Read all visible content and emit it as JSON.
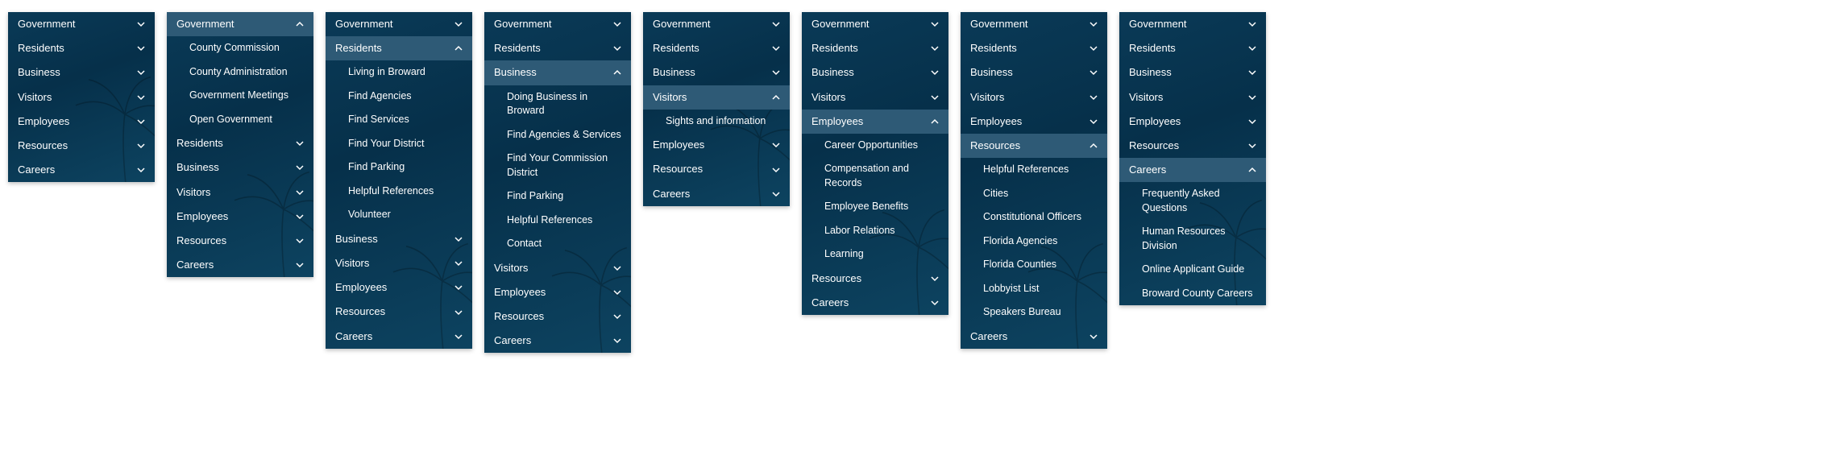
{
  "panels": [
    {
      "expanded_index": -1,
      "sections": [
        {
          "label": "Government",
          "children": []
        },
        {
          "label": "Residents",
          "children": []
        },
        {
          "label": "Business",
          "children": []
        },
        {
          "label": "Visitors",
          "children": []
        },
        {
          "label": "Employees",
          "children": []
        },
        {
          "label": "Resources",
          "children": []
        },
        {
          "label": "Careers",
          "children": []
        }
      ]
    },
    {
      "expanded_index": 0,
      "sections": [
        {
          "label": "Government",
          "children": [
            "County Commission",
            "County Administration",
            "Government Meetings",
            "Open Government"
          ]
        },
        {
          "label": "Residents",
          "children": []
        },
        {
          "label": "Business",
          "children": []
        },
        {
          "label": "Visitors",
          "children": []
        },
        {
          "label": "Employees",
          "children": []
        },
        {
          "label": "Resources",
          "children": []
        },
        {
          "label": "Careers",
          "children": []
        }
      ]
    },
    {
      "expanded_index": 1,
      "sections": [
        {
          "label": "Government",
          "children": []
        },
        {
          "label": "Residents",
          "children": [
            "Living in Broward",
            "Find Agencies",
            "Find Services",
            "Find Your District",
            "Find Parking",
            "Helpful References",
            "Volunteer"
          ]
        },
        {
          "label": "Business",
          "children": []
        },
        {
          "label": "Visitors",
          "children": []
        },
        {
          "label": "Employees",
          "children": []
        },
        {
          "label": "Resources",
          "children": []
        },
        {
          "label": "Careers",
          "children": []
        }
      ]
    },
    {
      "expanded_index": 2,
      "sections": [
        {
          "label": "Government",
          "children": []
        },
        {
          "label": "Residents",
          "children": []
        },
        {
          "label": "Business",
          "children": [
            "Doing Business in Broward",
            "Find Agencies & Services",
            "Find Your Commission District",
            "Find Parking",
            "Helpful References",
            "Contact"
          ]
        },
        {
          "label": "Visitors",
          "children": []
        },
        {
          "label": "Employees",
          "children": []
        },
        {
          "label": "Resources",
          "children": []
        },
        {
          "label": "Careers",
          "children": []
        }
      ]
    },
    {
      "expanded_index": 3,
      "sections": [
        {
          "label": "Government",
          "children": []
        },
        {
          "label": "Residents",
          "children": []
        },
        {
          "label": "Business",
          "children": []
        },
        {
          "label": "Visitors",
          "children": [
            "Sights and information"
          ]
        },
        {
          "label": "Employees",
          "children": []
        },
        {
          "label": "Resources",
          "children": []
        },
        {
          "label": "Careers",
          "children": []
        }
      ]
    },
    {
      "expanded_index": 4,
      "sections": [
        {
          "label": "Government",
          "children": []
        },
        {
          "label": "Residents",
          "children": []
        },
        {
          "label": "Business",
          "children": []
        },
        {
          "label": "Visitors",
          "children": []
        },
        {
          "label": "Employees",
          "children": [
            "Career Opportunities",
            "Compensation and Records",
            "Employee Benefits",
            "Labor Relations",
            "Learning"
          ]
        },
        {
          "label": "Resources",
          "children": []
        },
        {
          "label": "Careers",
          "children": []
        }
      ]
    },
    {
      "expanded_index": 5,
      "sections": [
        {
          "label": "Government",
          "children": []
        },
        {
          "label": "Residents",
          "children": []
        },
        {
          "label": "Business",
          "children": []
        },
        {
          "label": "Visitors",
          "children": []
        },
        {
          "label": "Employees",
          "children": []
        },
        {
          "label": "Resources",
          "children": [
            "Helpful References",
            "Cities",
            "Constitutional Officers",
            "Florida Agencies",
            "Florida Counties",
            "Lobbyist List",
            "Speakers Bureau"
          ]
        },
        {
          "label": "Careers",
          "children": []
        }
      ]
    },
    {
      "expanded_index": 6,
      "sections": [
        {
          "label": "Government",
          "children": []
        },
        {
          "label": "Residents",
          "children": []
        },
        {
          "label": "Business",
          "children": []
        },
        {
          "label": "Visitors",
          "children": []
        },
        {
          "label": "Employees",
          "children": []
        },
        {
          "label": "Resources",
          "children": []
        },
        {
          "label": "Careers",
          "children": [
            "Frequently Asked Questions",
            "Human Resources Division",
            "Online Applicant Guide",
            "Broward County Careers"
          ]
        }
      ]
    }
  ]
}
